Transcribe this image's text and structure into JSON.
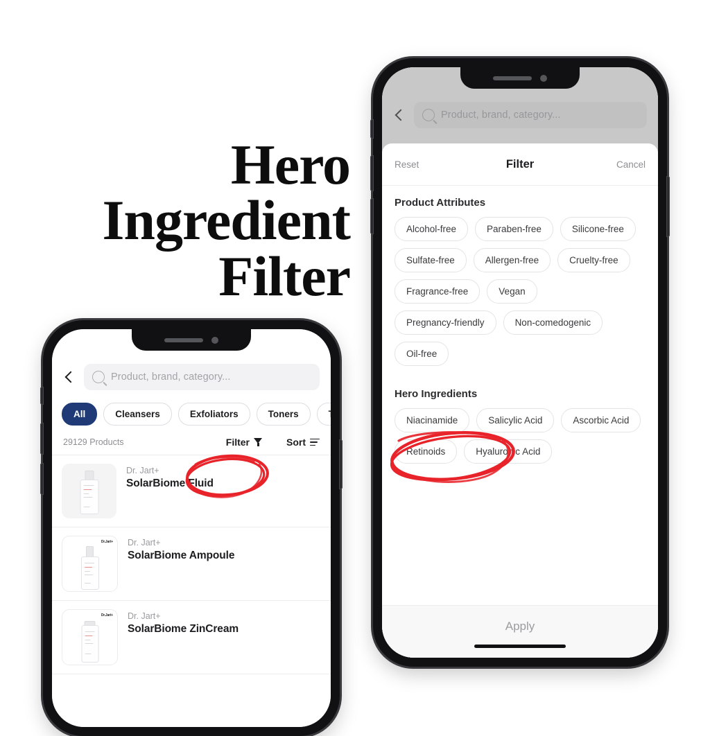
{
  "headline": {
    "lines": [
      "Hero",
      "Ingredient",
      "Filter"
    ]
  },
  "colors": {
    "accent_pill": "#1f3a77",
    "annotation_red": "#e8232a",
    "chip_border": "#e4e4e6",
    "text_primary": "#1d1d1f",
    "text_muted": "#8e8e93"
  },
  "browse_phone": {
    "back_icon": "chevron-left-icon",
    "search": {
      "icon": "search-icon",
      "placeholder": "Product, brand, category...",
      "value": ""
    },
    "categories": [
      {
        "label": "All",
        "selected": true
      },
      {
        "label": "Cleansers",
        "selected": false
      },
      {
        "label": "Exfoliators",
        "selected": false
      },
      {
        "label": "Toners",
        "selected": false
      },
      {
        "label": "Tr",
        "selected": false
      }
    ],
    "toolbar": {
      "count": "29129 Products",
      "filter_label": "Filter",
      "filter_icon": "funnel-icon",
      "sort_label": "Sort",
      "sort_icon": "sort-lines-icon"
    },
    "products": [
      {
        "brand": "Dr. Jart+",
        "name": "SolarBiome Fluid"
      },
      {
        "brand": "Dr. Jart+",
        "name": "SolarBiome Ampoule"
      },
      {
        "brand": "Dr. Jart+",
        "name": "SolarBiome ZinCream"
      }
    ]
  },
  "filter_phone": {
    "background": {
      "back_icon": "chevron-left-icon",
      "search_placeholder": "Product, brand, category..."
    },
    "sheet": {
      "reset_label": "Reset",
      "title": "Filter",
      "cancel_label": "Cancel",
      "sections": [
        {
          "title": "Product Attributes",
          "chips": [
            "Alcohol-free",
            "Paraben-free",
            "Silicone-free",
            "Sulfate-free",
            "Allergen-free",
            "Cruelty-free",
            "Fragrance-free",
            "Vegan",
            "Pregnancy-friendly",
            "Non-comedogenic",
            "Oil-free"
          ]
        },
        {
          "title": "Hero Ingredients",
          "chips": [
            "Niacinamide",
            "Salicylic Acid",
            "Ascorbic Acid",
            "Retinoids",
            "Hyaluronic Acid"
          ]
        }
      ],
      "apply_label": "Apply"
    }
  },
  "annotations": [
    {
      "name": "filter-button-circle",
      "target": "Filter"
    },
    {
      "name": "hero-ingredients-circle",
      "target": "Hero Ingredients"
    }
  ]
}
